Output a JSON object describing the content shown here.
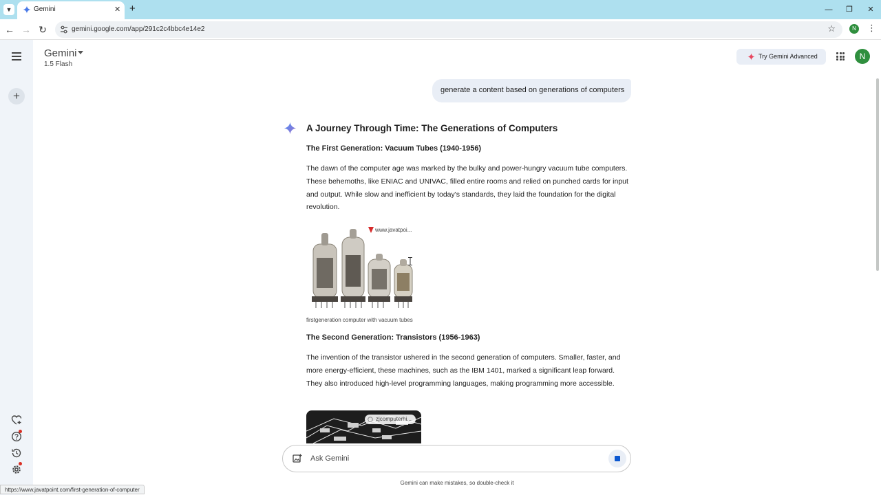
{
  "browser": {
    "tab_title": "Gemini",
    "url": "gemini.google.com/app/291c2c4bbc4e14e2",
    "profile_initial": "N",
    "status_url": "https://www.javatpoint.com/first-generation-of-computer"
  },
  "header": {
    "title": "Gemini",
    "model": "1.5 Flash",
    "advanced_label": "Try Gemini Advanced",
    "avatar_initial": "N"
  },
  "chat": {
    "user_prompt": "generate a content based on generations of computers",
    "response": {
      "title": "A Journey Through Time: The Generations of Computers",
      "sections": [
        {
          "heading": "The First Generation: Vacuum Tubes (1940-1956)",
          "body": "The dawn of the computer age was marked by the bulky and power-hungry vacuum tube computers. These behemoths, like ENIAC and UNIVAC, filled entire rooms and relied on punched cards for input and output. While slow and inefficient by today's standards, they laid the foundation for the digital revolution.",
          "image_source": "www.javatpoi...",
          "image_caption": "firstgeneration computer with vacuum tubes"
        },
        {
          "heading": "The Second Generation: Transistors (1956-1963)",
          "body": "The invention of the transistor ushered in the second generation of computers. Smaller, faster, and more energy-efficient, these machines, such as the IBM 1401, marked a significant leap forward. They also introduced high-level programming languages, making programming more accessible.",
          "image_source": "zjcomputerhi..."
        }
      ]
    }
  },
  "input": {
    "placeholder": "Ask Gemini",
    "disclaimer": "Gemini can make mistakes, so double-check it"
  },
  "colors": {
    "tabstrip": "#aee0ef",
    "sidebar": "#f0f4f9",
    "bubble": "#e9eef6",
    "accent": "#0b57d0",
    "avatar": "#2f8f3e"
  }
}
